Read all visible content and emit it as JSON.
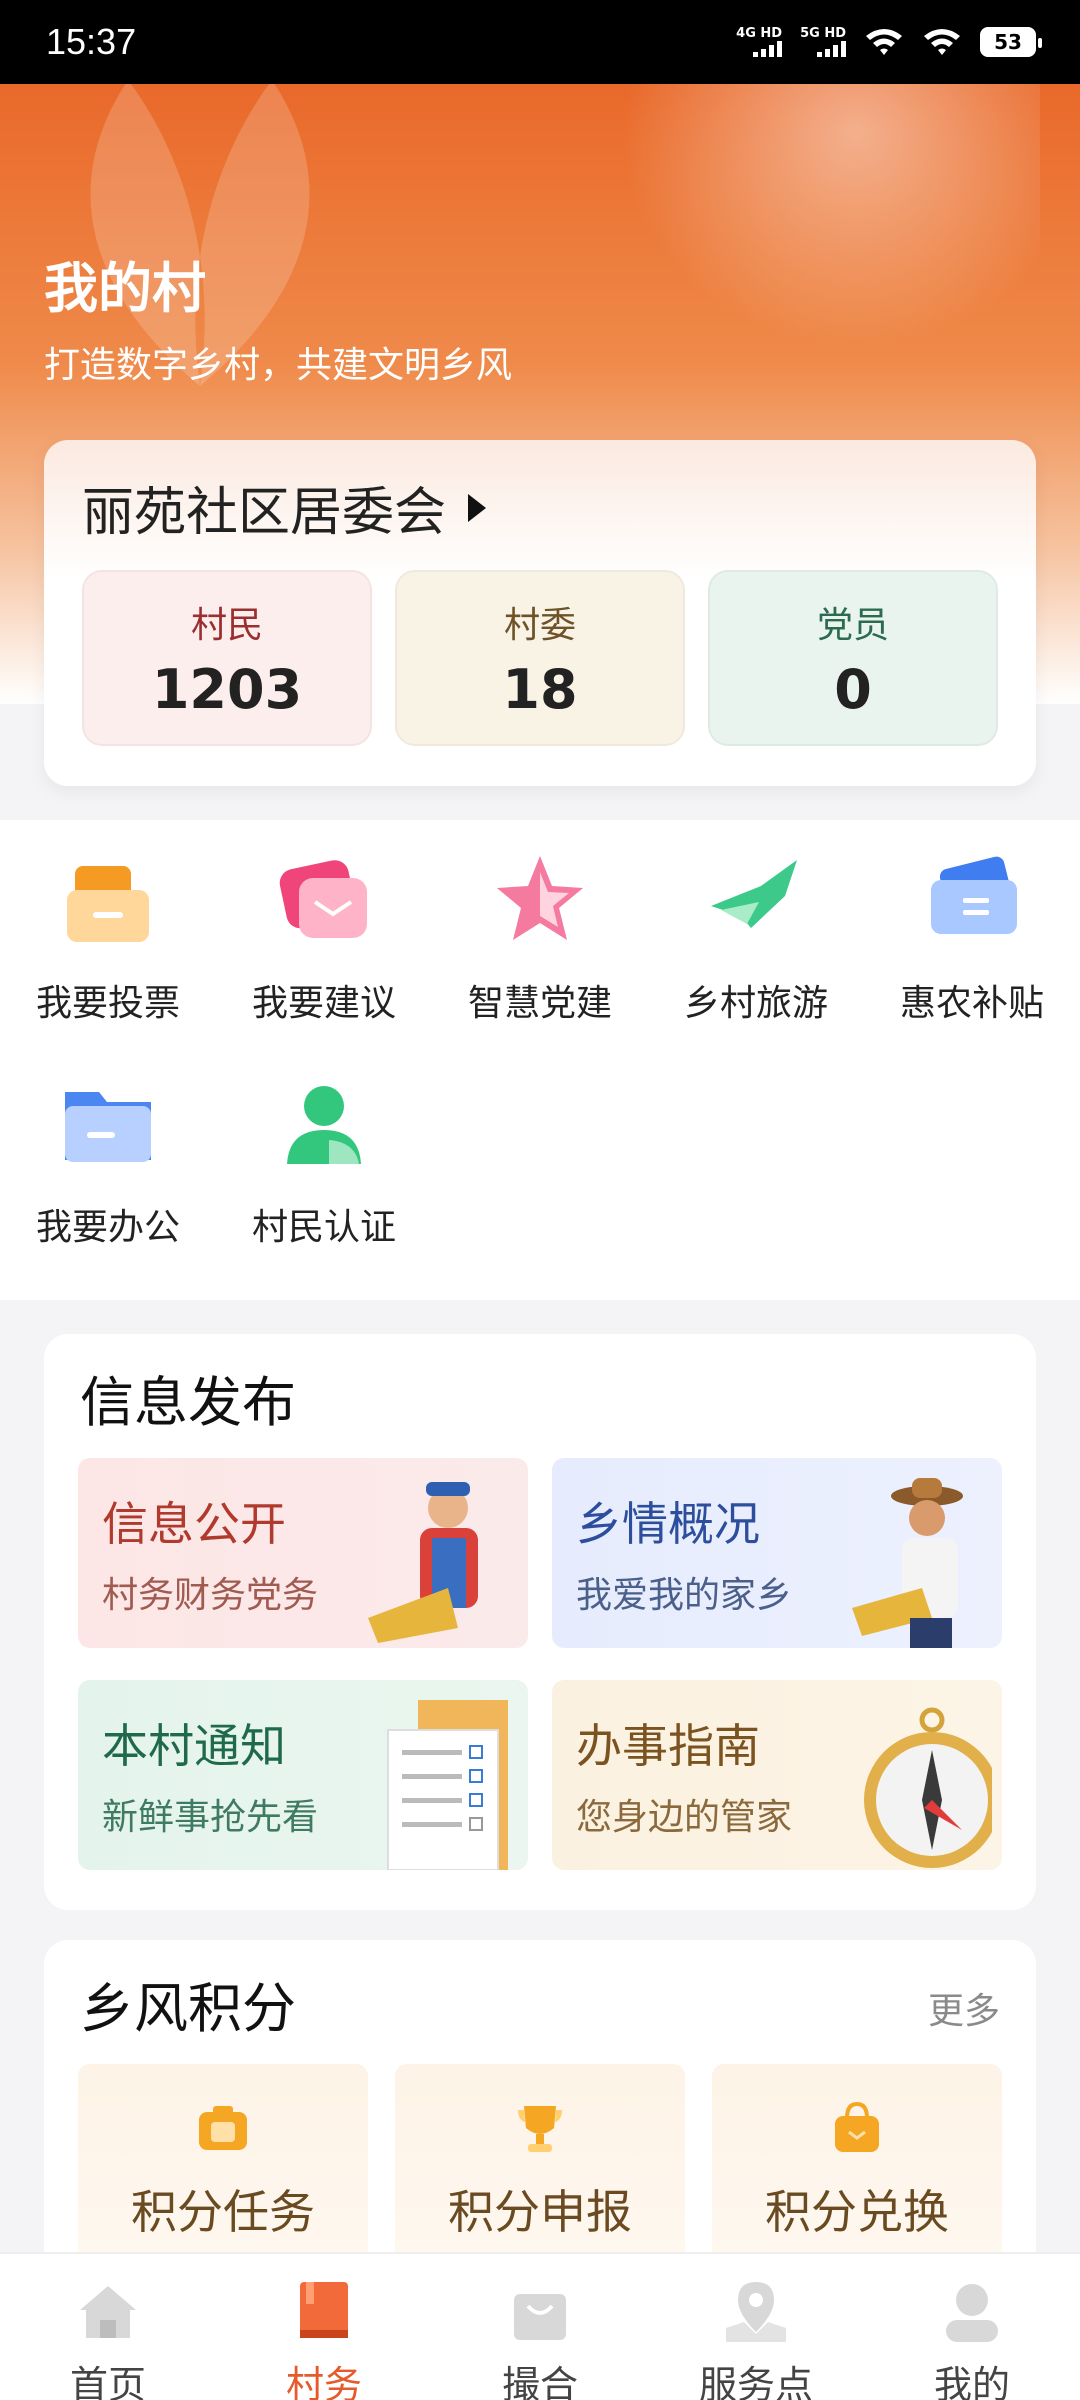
{
  "status": {
    "time": "15:37",
    "net1": "4G HD",
    "net2": "5G HD",
    "battery": "53"
  },
  "hero": {
    "title": "我的村",
    "subtitle": "打造数字乡村，共建文明乡风"
  },
  "community": {
    "name": "丽苑社区居委会",
    "stats": [
      {
        "label": "村民",
        "value": "1203"
      },
      {
        "label": "村委",
        "value": "18"
      },
      {
        "label": "党员",
        "value": "0"
      }
    ]
  },
  "quick": [
    {
      "label": "我要投票",
      "icon": "ballot-icon"
    },
    {
      "label": "我要建议",
      "icon": "mail-icon"
    },
    {
      "label": "智慧党建",
      "icon": "star-icon"
    },
    {
      "label": "乡村旅游",
      "icon": "plane-icon"
    },
    {
      "label": "惠农补贴",
      "icon": "ticket-icon"
    },
    {
      "label": "我要办公",
      "icon": "folder-icon"
    },
    {
      "label": "村民认证",
      "icon": "person-icon"
    }
  ],
  "info": {
    "title": "信息发布",
    "tiles": [
      {
        "title": "信息公开",
        "sub": "村务财务党务"
      },
      {
        "title": "乡情概况",
        "sub": "我爱我的家乡"
      },
      {
        "title": "本村通知",
        "sub": "新鲜事抢先看"
      },
      {
        "title": "办事指南",
        "sub": "您身边的管家"
      }
    ]
  },
  "points": {
    "title": "乡风积分",
    "more": "更多",
    "tiles": [
      {
        "label": "积分任务"
      },
      {
        "label": "积分申报"
      },
      {
        "label": "积分兑换"
      }
    ]
  },
  "nav": [
    {
      "label": "首页"
    },
    {
      "label": "村务"
    },
    {
      "label": "撮合"
    },
    {
      "label": "服务点"
    },
    {
      "label": "我的"
    }
  ],
  "colors": {
    "accent": "#e65a2b",
    "hero": "#e9692a"
  }
}
